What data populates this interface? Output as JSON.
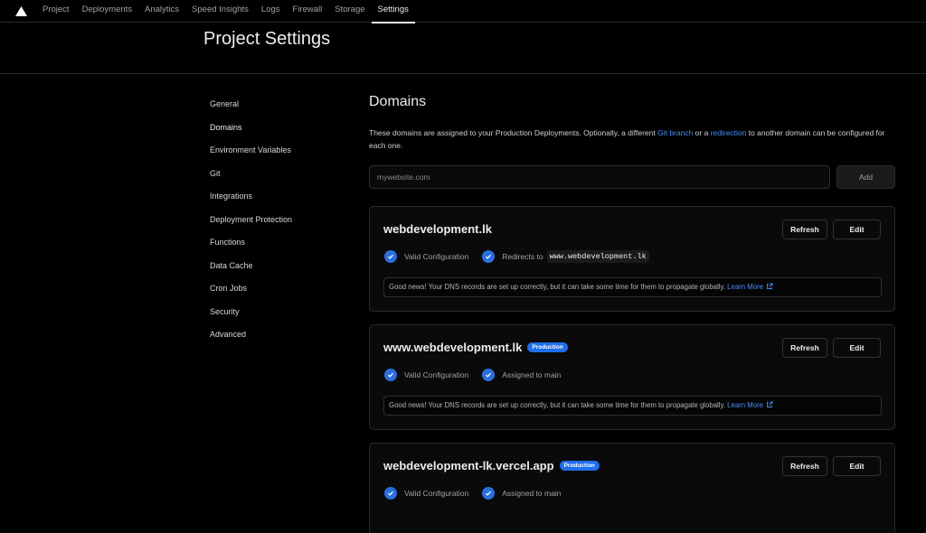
{
  "topnav": {
    "logo": "vercel-triangle-icon",
    "tabs": [
      {
        "label": "Project"
      },
      {
        "label": "Deployments"
      },
      {
        "label": "Analytics"
      },
      {
        "label": "Speed Insights"
      },
      {
        "label": "Logs"
      },
      {
        "label": "Firewall"
      },
      {
        "label": "Storage"
      },
      {
        "label": "Settings",
        "active": true
      }
    ]
  },
  "header": {
    "title": "Project Settings"
  },
  "sidebar": {
    "items": [
      {
        "label": "General"
      },
      {
        "label": "Domains",
        "active": true
      },
      {
        "label": "Environment Variables"
      },
      {
        "label": "Git"
      },
      {
        "label": "Integrations"
      },
      {
        "label": "Deployment Protection"
      },
      {
        "label": "Functions"
      },
      {
        "label": "Data Cache"
      },
      {
        "label": "Cron Jobs"
      },
      {
        "label": "Security"
      },
      {
        "label": "Advanced"
      }
    ]
  },
  "main": {
    "title": "Domains",
    "desc_1": "These domains are assigned to your Production Deployments. Optionally, a different ",
    "desc_link_1": "Git branch",
    "desc_2": " or a ",
    "desc_link_2": "redirection",
    "desc_3": " to another domain can be configured for each one.",
    "input_placeholder": "mywebsite.com",
    "input_value": "",
    "add_label": "Add",
    "refresh_label": "Refresh",
    "edit_label": "Edit",
    "notice_text": "Good news! Your DNS records are set up correctly, but it can take some time for them to propagate globally.",
    "learn_more": "Learn More",
    "domains": [
      {
        "name": "webdevelopment.lk",
        "badge": null,
        "status_1": "Valid Configuration",
        "status_2": "Redirects to",
        "status_2_code": "www.webdevelopment.lk"
      },
      {
        "name": "www.webdevelopment.lk",
        "badge": "Production",
        "status_1": "Valid Configuration",
        "status_2": "Assigned to main"
      },
      {
        "name": "webdevelopment-lk.vercel.app",
        "badge": "Production",
        "status_1": "Valid Configuration",
        "status_2": "Assigned to main"
      }
    ]
  },
  "colors": {
    "accent": "#1f6feb",
    "link": "#4a8cf5",
    "background": "#000000"
  }
}
